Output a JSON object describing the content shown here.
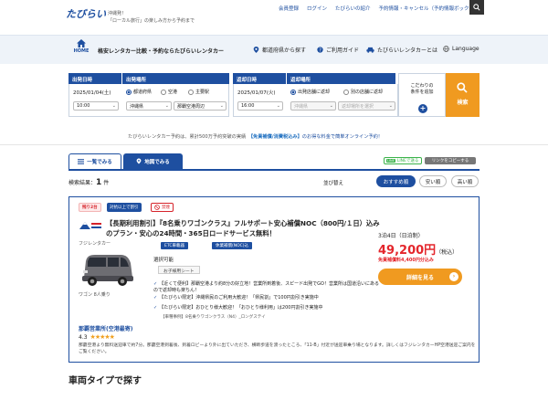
{
  "header": {
    "logo": "たびらい",
    "tagline1": "沖縄発！",
    "tagline2": "「ローカル旅行」の楽しみ方から予約まで",
    "links": [
      "会員登録",
      "ログイン",
      "たびらいの紹介",
      "予約情報・キャンセル（予約情報ボックス）"
    ]
  },
  "nav": {
    "home": "HOME",
    "title": "格安レンタカー比較・予約ならたびらいレンタカー",
    "links": [
      "都道府県から探す",
      "ご利用ガイド",
      "たびらいレンタカーとは",
      "Language"
    ]
  },
  "search": {
    "dep_date_label": "出発日時",
    "dep_place_label": "出発場所",
    "ret_date_label": "返却日時",
    "ret_place_label": "返却場所",
    "dep_date": "2025/01/04",
    "dep_date_dow": "(土)",
    "dep_time": "10:00",
    "dep_radio": [
      "都道府県",
      "空港",
      "主要駅"
    ],
    "dep_pref": "沖縄県",
    "dep_area": "那覇空港周辺",
    "ret_date": "2025/01/07",
    "ret_date_dow": "(火)",
    "ret_time": "16:00",
    "ret_radio": [
      "出発店舗に返却",
      "別の店舗に返却"
    ],
    "ret_pref": "沖縄県",
    "ret_area": "返却場所を選択",
    "cond_line1": "こだわりの",
    "cond_line2": "条件を追加",
    "search_button": "検索"
  },
  "notice": {
    "pre": "たびらいレンタカー予約は、累計500万予約突破の実績",
    "highlight": "【免責補償/消費税込み】",
    "post": "のお得な料金で簡単オンライン予約！"
  },
  "tabs": {
    "list": "一覧でみる",
    "map": "地図でみる",
    "line": "LINEで送る",
    "copy": "リンクをコピーする"
  },
  "results": {
    "label": "検索結果：",
    "count": "1",
    "unit": "件",
    "sort_label": "並び替え",
    "sort_options": [
      "おすすめ順",
      "安い順",
      "高い順"
    ]
  },
  "card": {
    "badges": [
      "残り2台",
      "対抗以上で割引",
      "禁煙"
    ],
    "title": "【長期利用割引】『8名乗りワゴンクラス』フルサポート安心補償NOC（800円/１日）込みのプラン・安心の24時間・365日ロードサービス無料！",
    "company": "フジレンタカー",
    "car_class": "ワゴン 8人乗り",
    "tags": [
      "ETC車載器",
      "休業補償(NOC)込"
    ],
    "option_label": "選択可能",
    "option_tag": "お子様用シート",
    "features": [
      "【近くて便利】那覇空港より約8分の好立地！営業所到着後、スピード出発でGO！営業所は国道沿いにあるので返却時も楽ちん！",
      "【たびらい限定】沖縄県民のご利用大歓迎！「県民割」で100円割引き実施中",
      "【たびらい限定】おひとり様大歓迎！「おひとり様利用」は200円割引き実施中"
    ],
    "car_code": "【車種事例】8名乗りワゴンクラス（N4）_ロングステイ",
    "days": "3泊4日（日泊制）",
    "price": "49,200円",
    "tax": "（税込）",
    "price_inc": "免責補償料4,400円分込み",
    "detail_button": "詳細を見る",
    "office": "那覇営業所(空港最寄)",
    "rating": "4.3",
    "office_desc": "那覇空港より無料送迎車で約7分。那覇空港到着後、到着ロビーより外に出ていただき、横断歩道を渡ったところ、「11-B」付近が送迎車乗り場となります。詳しくはフジレンタカーHP空港送迎ご案内をご覧ください。"
  },
  "section_title": "車両タイプで探す",
  "colors": {
    "primary": "#1e4fa0",
    "accent": "#f09a20",
    "price": "#e4262c"
  }
}
